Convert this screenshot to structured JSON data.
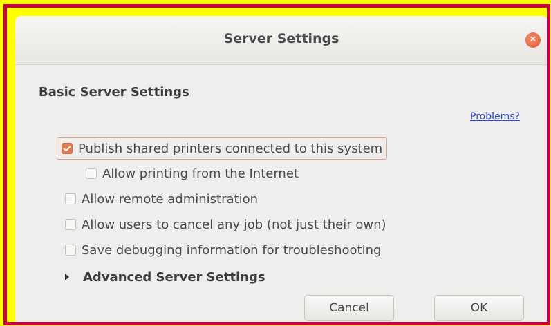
{
  "window": {
    "title": "Server Settings",
    "close_icon": "close-icon"
  },
  "section": {
    "title": "Basic Server Settings"
  },
  "problems_link": "Problems?",
  "options": [
    {
      "label": "Publish shared printers connected to this system",
      "checked": true
    },
    {
      "label": "Allow printing from the Internet",
      "checked": false
    },
    {
      "label": "Allow remote administration",
      "checked": false
    },
    {
      "label": "Allow users to cancel any job (not just their own)",
      "checked": false
    },
    {
      "label": "Save debugging information for troubleshooting",
      "checked": false
    }
  ],
  "advanced": {
    "label": "Advanced Server Settings",
    "icon": "disclosure-arrow-icon"
  },
  "buttons": {
    "cancel": "Cancel",
    "ok": "OK"
  },
  "colors": {
    "accent": "#e27a4e",
    "link": "#2b4ad0",
    "frame_outer": "#ffff00",
    "frame_border": "#cc0044"
  }
}
